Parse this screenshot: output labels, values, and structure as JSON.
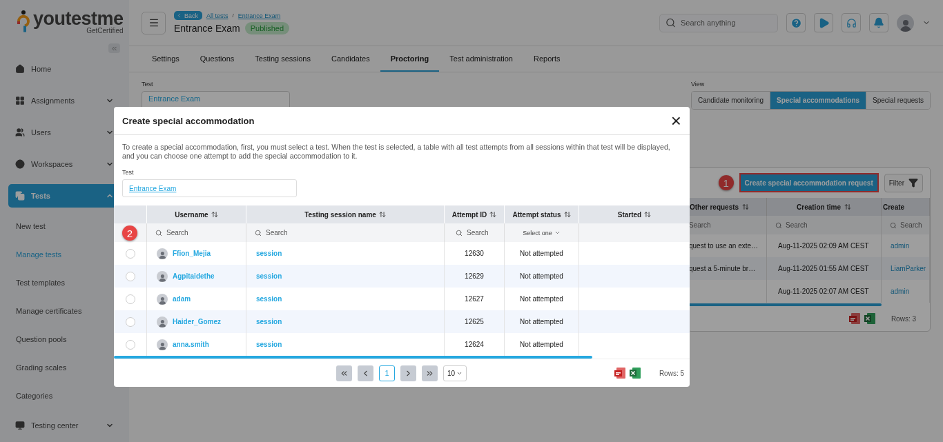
{
  "sidebar": {
    "logo": {
      "name": "youtestme",
      "tagline": "GetCertified"
    },
    "items": [
      {
        "label": "Home",
        "kind": "link",
        "selected": false
      },
      {
        "label": "Assignments",
        "kind": "group",
        "expanded": false,
        "selected": false
      },
      {
        "label": "Users",
        "kind": "group",
        "expanded": false,
        "selected": false
      },
      {
        "label": "Workspaces",
        "kind": "group",
        "expanded": false,
        "selected": false
      },
      {
        "label": "Tests",
        "kind": "group",
        "expanded": true,
        "selected": true,
        "children": [
          {
            "label": "New test",
            "selected": false
          },
          {
            "label": "Manage tests",
            "selected": true
          },
          {
            "label": "Test templates",
            "selected": false
          },
          {
            "label": "Manage certificates",
            "selected": false
          },
          {
            "label": "Question pools",
            "selected": false
          },
          {
            "label": "Grading scales",
            "selected": false
          },
          {
            "label": "Categories",
            "selected": false
          }
        ]
      },
      {
        "label": "Testing center",
        "kind": "group",
        "expanded": false,
        "selected": false
      }
    ]
  },
  "header": {
    "back": "Back",
    "breadcrumbs": [
      "All tests",
      "Entrance Exam"
    ],
    "separator": "/",
    "title": "Entrance Exam",
    "status": "Published",
    "search": {
      "placeholder": "Search anything"
    }
  },
  "tabs": [
    {
      "label": "Settings",
      "selected": false
    },
    {
      "label": "Questions",
      "selected": false
    },
    {
      "label": "Testing sessions",
      "selected": false
    },
    {
      "label": "Candidates",
      "selected": false
    },
    {
      "label": "Proctoring",
      "selected": true
    },
    {
      "label": "Test administration",
      "selected": false
    },
    {
      "label": "Reports",
      "selected": false
    }
  ],
  "test_field": {
    "label": "Test",
    "value": "Entrance Exam"
  },
  "view": {
    "label": "View",
    "options": [
      {
        "label": "Candidate monitoring",
        "selected": false
      },
      {
        "label": "Special accommodations",
        "selected": true
      },
      {
        "label": "Special requests",
        "selected": false
      }
    ]
  },
  "requests_panel": {
    "step": "1",
    "create_button": "Create special accommodation request",
    "filter": "Filter",
    "columns": [
      {
        "label": "Other requests",
        "placeholder": "Search"
      },
      {
        "label": "Creation time",
        "placeholder": "Search"
      },
      {
        "label": "Create",
        "placeholder": "Search"
      }
    ],
    "rows": [
      {
        "other": "quest to use an exte…",
        "time": "Aug-11-2025 02:09 AM CEST",
        "created_by": "admin"
      },
      {
        "other": "quest a 5-minute br…",
        "time": "Aug-11-2025 01:55 AM CEST",
        "created_by": "LiamParker"
      },
      {
        "time": "Aug-11-2025 02:07 AM CEST",
        "created_by": "admin"
      }
    ],
    "rows_count": "Rows: 3"
  },
  "modal": {
    "title": "Create special accommodation",
    "close": "×",
    "description": "To create a special accommodation, first, you must select a test. When the test is selected, a table with all test attempts from all sessions within that test will be displayed, and you can choose one attempt to add the special accommodation to it.",
    "test_label": "Test",
    "test_value": "Entrance Exam",
    "step": "2",
    "columns": [
      {
        "label": "Username",
        "search_placeholder": "Search"
      },
      {
        "label": "Testing session name",
        "search_placeholder": "Search"
      },
      {
        "label": "Attempt ID",
        "search_placeholder": "Search"
      },
      {
        "label": "Attempt status",
        "select_placeholder": "Select one"
      },
      {
        "label": "Started"
      }
    ],
    "rows": [
      {
        "username": "Ffion_Mejia",
        "session": "session",
        "attempt_id": "12630",
        "status": "Not attempted",
        "selected": false
      },
      {
        "username": "Agpitaidethe",
        "session": "session",
        "attempt_id": "12629",
        "status": "Not attempted",
        "selected": false
      },
      {
        "username": "adam",
        "session": "session",
        "attempt_id": "12627",
        "status": "Not attempted",
        "selected": false
      },
      {
        "username": "Haider_Gomez",
        "session": "session",
        "attempt_id": "12625",
        "status": "Not attempted",
        "selected": false
      },
      {
        "username": "anna.smith",
        "session": "session",
        "attempt_id": "12624",
        "status": "Not attempted",
        "selected": false
      }
    ],
    "pagination": {
      "pages": [
        {
          "label": "1",
          "selected": true
        }
      ],
      "page_size": "10"
    },
    "rows_count": "Rows: 5"
  }
}
